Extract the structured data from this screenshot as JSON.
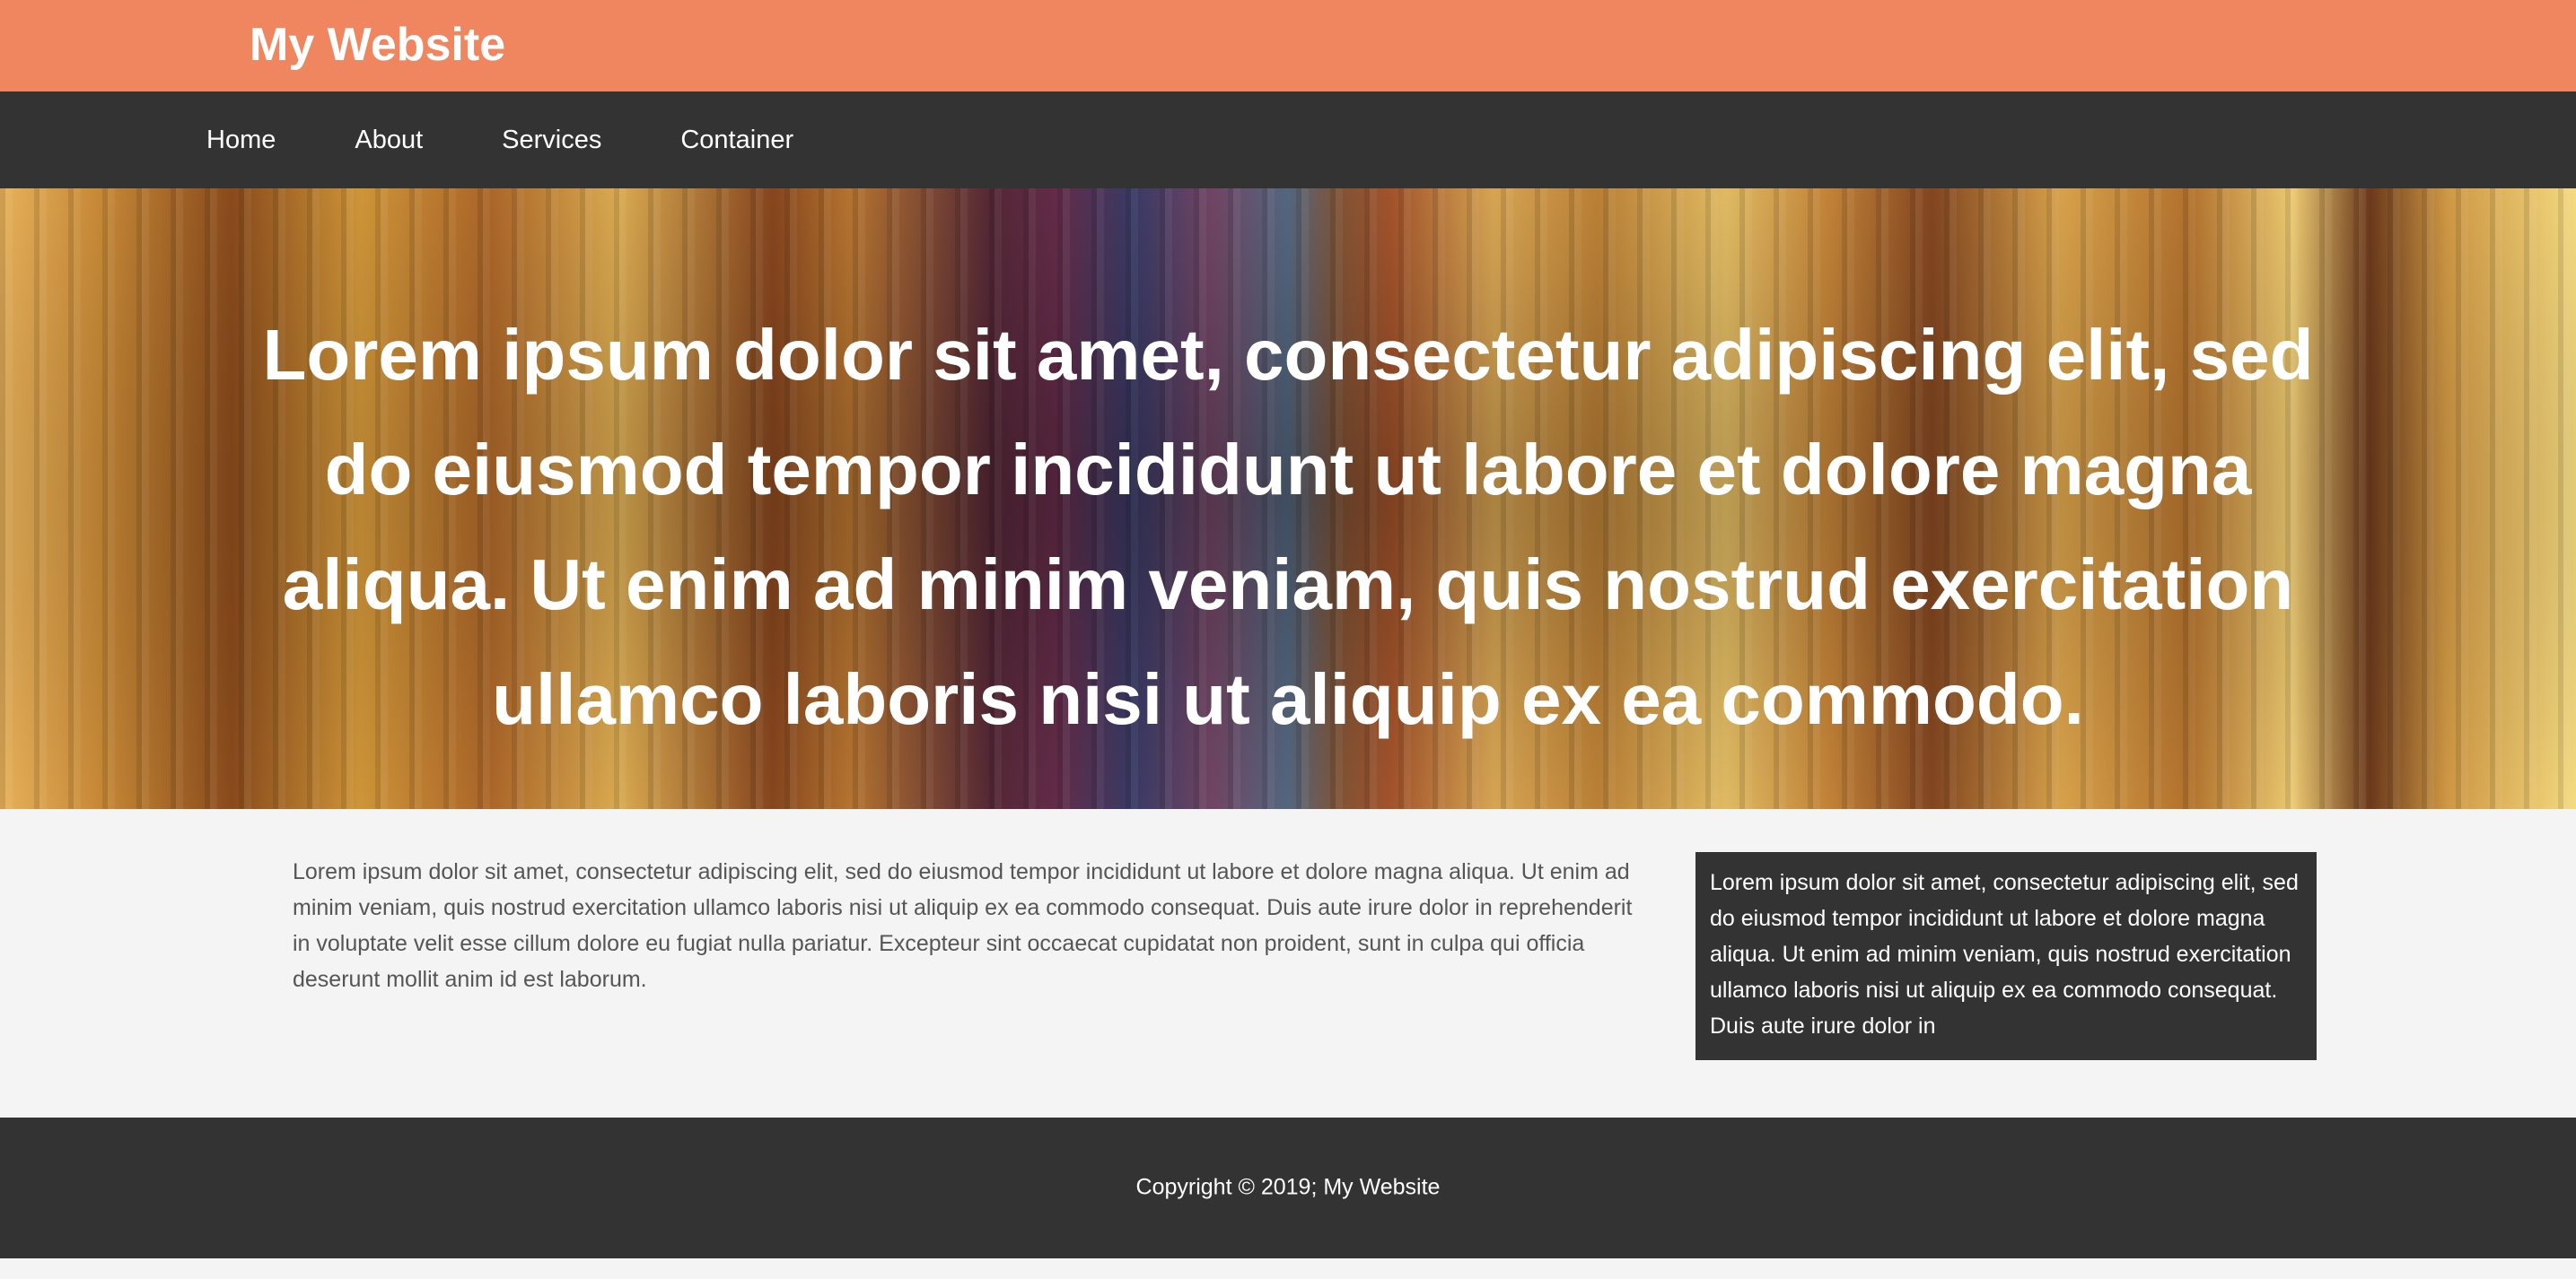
{
  "header": {
    "title": "My Website"
  },
  "nav": {
    "items": [
      {
        "label": "Home"
      },
      {
        "label": "About"
      },
      {
        "label": "Services"
      },
      {
        "label": "Container"
      }
    ]
  },
  "hero": {
    "text": "Lorem ipsum dolor sit amet, consectetur adipiscing elit, sed do eiusmod tempor incididunt ut labore et dolore magna aliqua. Ut enim ad minim veniam, quis nostrud exercitation ullamco laboris nisi ut aliquip ex ea commodo."
  },
  "main": {
    "text": "Lorem ipsum dolor sit amet, consectetur adipiscing elit, sed do eiusmod tempor incididunt ut labore et dolore magna aliqua. Ut enim ad minim veniam, quis nostrud exercitation ullamco laboris nisi ut aliquip ex ea commodo consequat. Duis aute irure dolor in reprehenderit in voluptate velit esse cillum dolore eu fugiat nulla pariatur. Excepteur sint occaecat cupidatat non proident, sunt in culpa qui officia deserunt mollit anim id est laborum."
  },
  "sidebar": {
    "text": "Lorem ipsum dolor sit amet, consectetur adipiscing elit, sed do eiusmod tempor incididunt ut labore et dolore magna aliqua. Ut enim ad minim veniam, quis nostrud exercitation ullamco laboris nisi ut aliquip ex ea commodo consequat. Duis aute irure dolor in"
  },
  "footer": {
    "copyright": "Copyright © 2019; My Website"
  },
  "colors": {
    "header_bg": "#f0865f",
    "nav_bg": "#333333",
    "page_bg": "#f4f4f4",
    "sidebar_bg": "#333333",
    "footer_bg": "#333333",
    "text_light": "#ffffff",
    "text_body": "#555555"
  }
}
